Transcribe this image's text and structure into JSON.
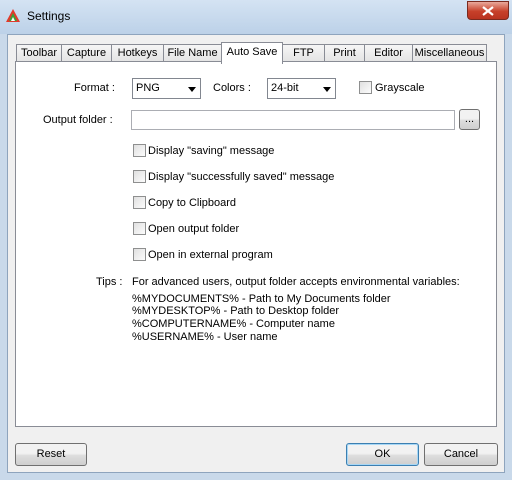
{
  "window": {
    "title": "Settings",
    "icon": "app-icon",
    "close_icon": "close-icon"
  },
  "tabs": [
    {
      "label": "Toolbar"
    },
    {
      "label": "Capture"
    },
    {
      "label": "Hotkeys"
    },
    {
      "label": "File Name"
    },
    {
      "label": "Auto Save",
      "active": true
    },
    {
      "label": "FTP"
    },
    {
      "label": "Print"
    },
    {
      "label": "Editor"
    },
    {
      "label": "Miscellaneous"
    }
  ],
  "format": {
    "label": "Format :",
    "value": "PNG"
  },
  "colors": {
    "label": "Colors :",
    "value": "24-bit"
  },
  "grayscale": {
    "label": "Grayscale",
    "checked": false
  },
  "output_folder": {
    "label": "Output folder :",
    "value": "",
    "browse_label": "..."
  },
  "options": [
    {
      "label": "Display \"saving\" message",
      "checked": false
    },
    {
      "label": "Display \"successfully saved\" message",
      "checked": false
    },
    {
      "label": "Copy to Clipboard",
      "checked": false
    },
    {
      "label": "Open output folder",
      "checked": false
    },
    {
      "label": "Open in external program",
      "checked": false
    }
  ],
  "tips": {
    "label": "Tips :",
    "lines": [
      "For advanced users, output folder accepts environmental variables:",
      "%MYDOCUMENTS% - Path to My Documents folder",
      "%MYDESKTOP% - Path to Desktop folder",
      "%COMPUTERNAME% - Computer name",
      "%USERNAME% - User name"
    ]
  },
  "buttons": {
    "reset": "Reset",
    "ok": "OK",
    "cancel": "Cancel"
  }
}
